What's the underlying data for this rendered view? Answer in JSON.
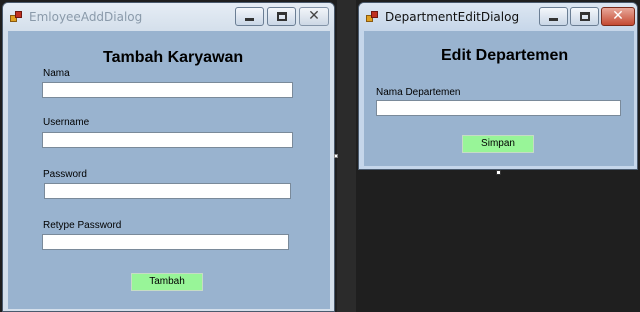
{
  "employee_dialog": {
    "title": "EmloyeeAddDialog",
    "heading": "Tambah Karyawan",
    "fields": [
      {
        "label": "Nama",
        "value": ""
      },
      {
        "label": "Username",
        "value": ""
      },
      {
        "label": "Password",
        "value": ""
      },
      {
        "label": "Retype Password",
        "value": ""
      }
    ],
    "submit_label": "Tambah",
    "close_glyph": "✕"
  },
  "department_dialog": {
    "title": "DepartmentEditDialog",
    "heading": "Edit Departemen",
    "fields": [
      {
        "label": "Nama Departemen",
        "value": ""
      }
    ],
    "submit_label": "Simpan",
    "close_glyph": "✕"
  },
  "colors": {
    "form_background": "#99b3cf",
    "button_background": "#98f598",
    "designer_background": "#1f1f1f"
  },
  "icons": [
    "app-form-icon",
    "minimize-icon",
    "maximize-icon",
    "close-icon"
  ]
}
